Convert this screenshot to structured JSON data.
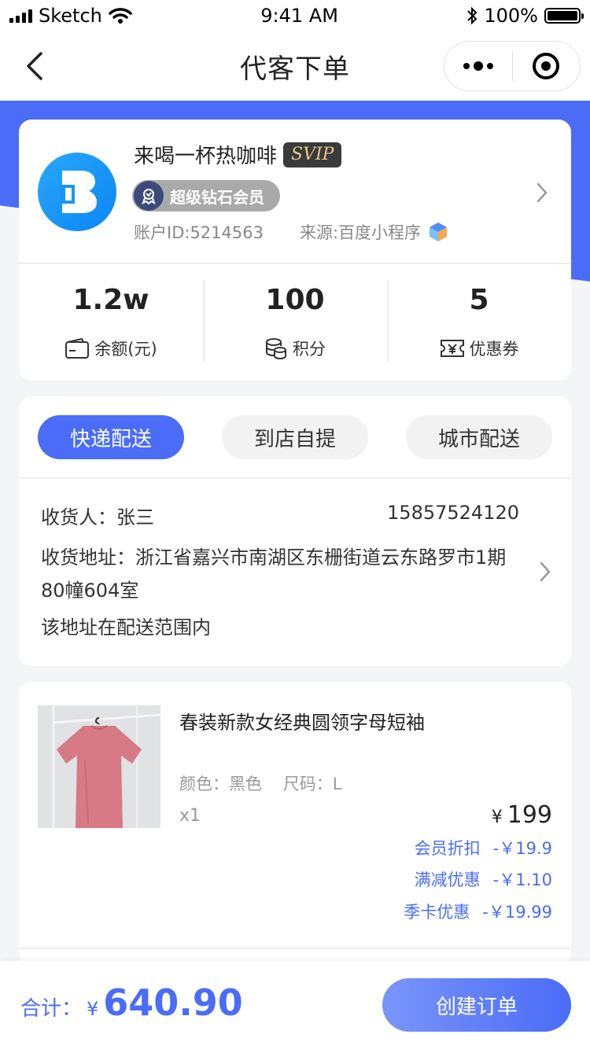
{
  "status_bar": {
    "carrier": "Sketch",
    "time": "9:41 AM",
    "battery": "100%"
  },
  "nav": {
    "title": "代客下单"
  },
  "member": {
    "name": "来喝一杯热咖啡",
    "tier_badge": "SVIP",
    "level": "超级钻石会员",
    "account_id": "账户ID:5214563",
    "source": "来源:百度小程序",
    "stats": [
      {
        "value": "1.2w",
        "label": "余额(元)",
        "icon": "wallet-icon"
      },
      {
        "value": "100",
        "label": "积分",
        "icon": "coins-icon"
      },
      {
        "value": "5",
        "label": "优惠券",
        "icon": "coupon-icon"
      }
    ]
  },
  "delivery": {
    "tabs": [
      {
        "label": "快递配送",
        "active": true
      },
      {
        "label": "到店自提",
        "active": false
      },
      {
        "label": "城市配送",
        "active": false
      }
    ],
    "recipient": "收货人：张三",
    "phone": "15857524120",
    "address": "收货地址：浙江省嘉兴市南湖区东栅街道云东路罗市1期80幢604室",
    "range_note": "该地址在配送范围内"
  },
  "product": {
    "title": "春装新款女经典圆领字母短袖",
    "spec": "颜色：黑色    尺码：L",
    "qty": "x1",
    "price_symbol": "¥",
    "price": "199",
    "discounts": [
      {
        "label": "会员折扣",
        "amount": "-￥19.9"
      },
      {
        "label": "满减优惠",
        "amount": "-￥1.10"
      },
      {
        "label": "季卡优惠",
        "amount": "-￥19.99"
      }
    ]
  },
  "footer": {
    "total_label": "合计：",
    "total_symbol": "¥",
    "total_amount": "640.90",
    "create_label": "创建订单"
  },
  "colors": {
    "primary": "#4a6cf7",
    "svip_bg": "#3a3a3a",
    "svip_text": "#e8c48a"
  }
}
